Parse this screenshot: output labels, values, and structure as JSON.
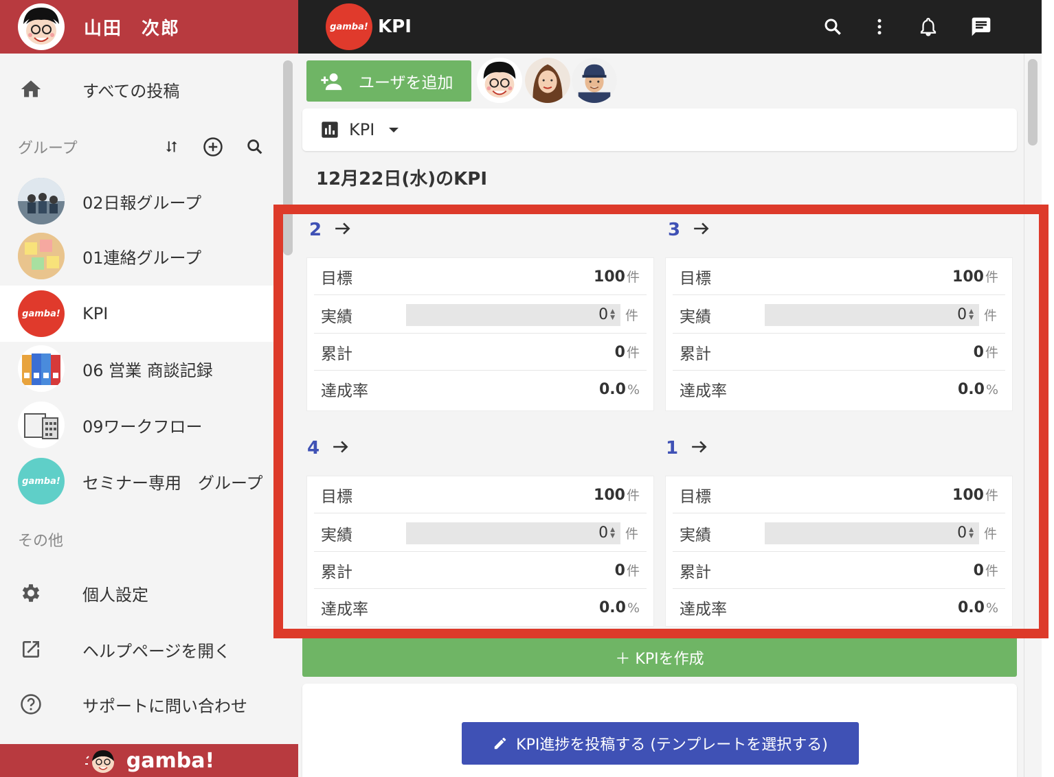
{
  "user": {
    "name": "山田　次郎"
  },
  "sidebar": {
    "all_posts": "すべての投稿",
    "groups_label": "グループ",
    "groups": [
      {
        "label": "02日報グループ"
      },
      {
        "label": "01連絡グループ"
      },
      {
        "label": "KPI",
        "active": true
      },
      {
        "label": "06 営業 商談記録"
      },
      {
        "label": "09ワークフロー"
      },
      {
        "label": "セミナー専用　グループ"
      }
    ],
    "others_label": "その他",
    "settings": "個人設定",
    "help": "ヘルプページを開く",
    "support": "サポートに問い合わせ",
    "brand": "gamba!"
  },
  "logo_text": "gamba!",
  "header": {
    "group_title": "KPI"
  },
  "toolbar": {
    "add_user_label": "ユーザを追加"
  },
  "kpi_select": {
    "selected": "KPI"
  },
  "kpi_section": {
    "date_heading": "12月22日(水)のKPI",
    "labels": {
      "target": "目標",
      "actual": "実績",
      "cumulative": "累計",
      "rate": "達成率"
    },
    "units": {
      "count": "件",
      "percent": "%"
    },
    "cards": [
      {
        "number": "2",
        "target": "100",
        "actual": "0",
        "cumulative": "0",
        "rate": "0.0"
      },
      {
        "number": "3",
        "target": "100",
        "actual": "0",
        "cumulative": "0",
        "rate": "0.0"
      },
      {
        "number": "4",
        "target": "100",
        "actual": "0",
        "cumulative": "0",
        "rate": "0.0"
      },
      {
        "number": "1",
        "target": "100",
        "actual": "0",
        "cumulative": "0",
        "rate": "0.0"
      }
    ]
  },
  "actions": {
    "create_kpi": "＋ KPIを作成",
    "post_kpi": "KPI進捗を投稿する (テンプレートを選択する)"
  },
  "colors": {
    "brand_red": "#b83a3f",
    "logo_red": "#e03a2c",
    "green": "#6fb565",
    "indigo": "#3f51b5",
    "highlight": "#dd3a2a"
  }
}
